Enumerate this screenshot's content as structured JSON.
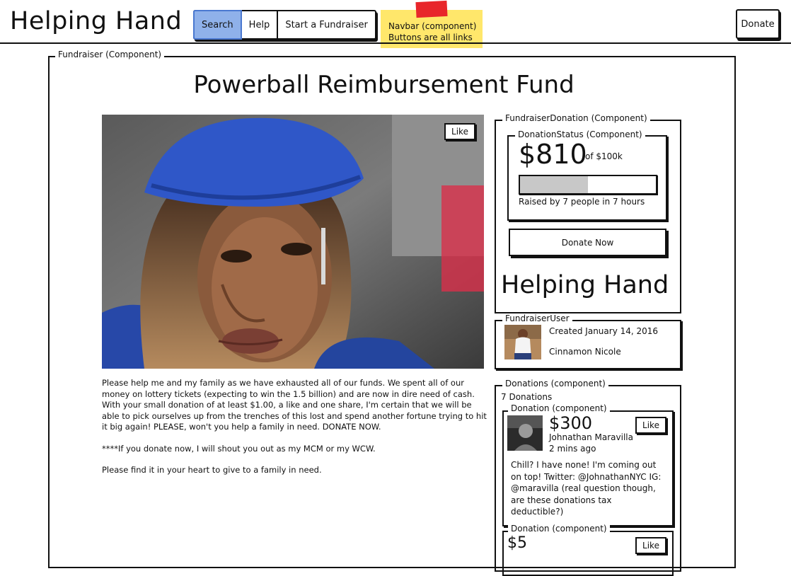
{
  "navbar": {
    "brand": "Helping Hand",
    "items": [
      "Search",
      "Help",
      "Start a Fundraiser"
    ],
    "donate_label": "Donate",
    "sticky_note": [
      "Navbar (component)",
      "Buttons are all links"
    ]
  },
  "fundraiser": {
    "component_label": "Fundraiser (Component)",
    "title": "Powerball Reimbursement Fund",
    "photo_like_label": "Like",
    "story": [
      "Please help me and my family as we have exhausted all of our funds. We spent all of our money on lottery tickets (expecting to win the 1.5 billion) and are now in dire need of cash. With your small donation of at least $1.00, a like and one share, I'm certain that we will be able to pick ourselves up from the trenches of this lost and spend another fortune trying to hit it big again! PLEASE, won't you help a family in need. DONATE NOW.",
      "****If you donate now, I will shout you out as my MCM or my WCW.",
      "Please find it in your heart to give to a family in need."
    ]
  },
  "fundraiser_donation": {
    "component_label": "FundraiserDonation (Component)",
    "status_label": "DonationStatus (Component)",
    "amount": "$810",
    "goal": "of $100k",
    "progress_fraction": 0.5,
    "raised_text": "Raised by 7 people in 7 hours",
    "donate_now_label": "Donate Now",
    "brand": "Helping Hand"
  },
  "fundraiser_user": {
    "component_label": "FundraiserUser",
    "created": "Created January 14, 2016",
    "name": "Cinnamon Nicole"
  },
  "donations": {
    "component_label": "Donations (component)",
    "count_text": "7 Donations",
    "items": [
      {
        "component_label": "Donation (component)",
        "amount": "$300",
        "name": "Johnathan Maravilla",
        "time": "2 mins ago",
        "message": "Chill? I have none! I'm coming out on top! Twitter: @JohnathanNYC IG: @maravilla (real question though, are these donations tax deductible?)",
        "like_label": "Like"
      },
      {
        "component_label": "Donation (component)",
        "amount": "$5",
        "like_label": "Like"
      }
    ]
  }
}
